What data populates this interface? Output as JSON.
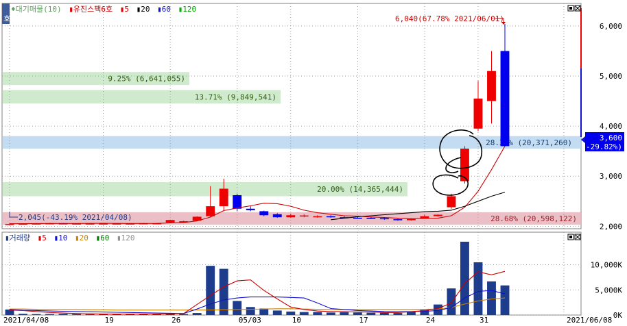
{
  "price_legend": {
    "prefix": "♦대기매물(10)",
    "stock": "유진스팩6호",
    "ma": [
      {
        "label": "5",
        "color": "#e00000"
      },
      {
        "label": "20",
        "color": "#000000"
      },
      {
        "label": "60",
        "color": "#1010d0"
      },
      {
        "label": "120",
        "color": "#00b000"
      }
    ]
  },
  "volume_legend": {
    "prefix": "거래량",
    "ma": [
      {
        "label": "5",
        "color": "#e00000"
      },
      {
        "label": "10",
        "color": "#1010d0"
      },
      {
        "label": "20",
        "color": "#d08000"
      },
      {
        "label": "60",
        "color": "#008000"
      },
      {
        "label": "120",
        "color": "#909090"
      }
    ]
  },
  "annotations": {
    "high": "6,040(67.78% 2021/06/01)",
    "low": "2,045(-43.19% 2021/04/08)",
    "current_price": "3,600",
    "current_change": "(-29.82%)"
  },
  "chart_data": [
    {
      "type": "candlestick",
      "dates": [
        "04/08",
        "04/09",
        "04/12",
        "04/13",
        "04/14",
        "04/15",
        "04/16",
        "04/19",
        "04/20",
        "04/21",
        "04/22",
        "04/23",
        "04/26",
        "04/27",
        "04/28",
        "04/29",
        "04/30",
        "05/03",
        "05/04",
        "05/06",
        "05/07",
        "05/10",
        "05/11",
        "05/12",
        "05/13",
        "05/14",
        "05/17",
        "05/18",
        "05/20",
        "05/21",
        "05/24",
        "05/25",
        "05/26",
        "05/27",
        "05/28",
        "05/31",
        "06/01"
      ],
      "candles": [
        {
          "o": 2045,
          "h": 2060,
          "l": 2045,
          "c": 2045
        },
        {
          "o": 2050,
          "h": 2055,
          "l": 2045,
          "c": 2050
        },
        {
          "o": 2055,
          "h": 2060,
          "l": 2050,
          "c": 2055
        },
        {
          "o": 2060,
          "h": 2065,
          "l": 2055,
          "c": 2060
        },
        {
          "o": 2060,
          "h": 2065,
          "l": 2055,
          "c": 2055
        },
        {
          "o": 2055,
          "h": 2060,
          "l": 2050,
          "c": 2055
        },
        {
          "o": 2055,
          "h": 2060,
          "l": 2050,
          "c": 2055
        },
        {
          "o": 2055,
          "h": 2060,
          "l": 2050,
          "c": 2055
        },
        {
          "o": 2055,
          "h": 2060,
          "l": 2050,
          "c": 2055
        },
        {
          "o": 2055,
          "h": 2060,
          "l": 2050,
          "c": 2055
        },
        {
          "o": 2060,
          "h": 2065,
          "l": 2055,
          "c": 2060
        },
        {
          "o": 2060,
          "h": 2065,
          "l": 2055,
          "c": 2060
        },
        {
          "o": 2075,
          "h": 2130,
          "l": 2070,
          "c": 2125
        },
        {
          "o": 2100,
          "h": 2110,
          "l": 2090,
          "c": 2100
        },
        {
          "o": 2110,
          "h": 2200,
          "l": 2100,
          "c": 2190
        },
        {
          "o": 2200,
          "h": 2800,
          "l": 2180,
          "c": 2400
        },
        {
          "o": 2400,
          "h": 2950,
          "l": 2300,
          "c": 2750
        },
        {
          "o": 2620,
          "h": 2650,
          "l": 2300,
          "c": 2350
        },
        {
          "o": 2350,
          "h": 2400,
          "l": 2300,
          "c": 2320
        },
        {
          "o": 2300,
          "h": 2310,
          "l": 2200,
          "c": 2220
        },
        {
          "o": 2240,
          "h": 2260,
          "l": 2170,
          "c": 2180
        },
        {
          "o": 2180,
          "h": 2250,
          "l": 2170,
          "c": 2220
        },
        {
          "o": 2200,
          "h": 2240,
          "l": 2180,
          "c": 2215
        },
        {
          "o": 2190,
          "h": 2220,
          "l": 2170,
          "c": 2200
        },
        {
          "o": 2200,
          "h": 2220,
          "l": 2170,
          "c": 2180
        },
        {
          "o": 2180,
          "h": 2200,
          "l": 2160,
          "c": 2175
        },
        {
          "o": 2170,
          "h": 2190,
          "l": 2150,
          "c": 2165
        },
        {
          "o": 2165,
          "h": 2185,
          "l": 2145,
          "c": 2160
        },
        {
          "o": 2160,
          "h": 2180,
          "l": 2130,
          "c": 2140
        },
        {
          "o": 2140,
          "h": 2150,
          "l": 2110,
          "c": 2120
        },
        {
          "o": 2120,
          "h": 2160,
          "l": 2110,
          "c": 2145
        },
        {
          "o": 2160,
          "h": 2230,
          "l": 2150,
          "c": 2200
        },
        {
          "o": 2200,
          "h": 2240,
          "l": 2190,
          "c": 2230
        },
        {
          "o": 2380,
          "h": 2650,
          "l": 2350,
          "c": 2600
        },
        {
          "o": 2900,
          "h": 3600,
          "l": 2850,
          "c": 3550
        },
        {
          "o": 3950,
          "h": 4900,
          "l": 3900,
          "c": 4550
        },
        {
          "o": 4500,
          "h": 5500,
          "l": 4050,
          "c": 5100
        }
      ],
      "last_candle": {
        "date": "06/01",
        "o": 5500,
        "h": 6040,
        "l": 3600,
        "c": 3600
      },
      "ma5": [
        2050,
        2052,
        2054,
        2056,
        2056,
        2056,
        2057,
        2058,
        2057,
        2056,
        2056,
        2057,
        2067,
        2075,
        2106,
        2183,
        2313,
        2365,
        2408,
        2460,
        2450,
        2400,
        2320,
        2270,
        2240,
        2210,
        2200,
        2185,
        2175,
        2160,
        2150,
        2155,
        2160,
        2210,
        2380,
        2700,
        3130,
        3600
      ],
      "ma20": [
        2130,
        2160,
        2190,
        2210,
        2230,
        2250,
        2270,
        2290,
        2300,
        2320,
        2400,
        2500,
        2600,
        2680
      ],
      "y_range": [
        1950,
        6450
      ],
      "yticks": [
        {
          "v": 2000,
          "label": "2,000"
        },
        {
          "v": 3000,
          "label": "3,000"
        },
        {
          "v": 4000,
          "label": "4,000"
        },
        {
          "v": 5000,
          "label": "5,000"
        },
        {
          "v": 6000,
          "label": "6,000"
        }
      ],
      "supply_zones": [
        {
          "lo": 2030,
          "hi": 2280,
          "label": "28.68% (20,598,122)",
          "color": "#e8b4bc",
          "text_color": "#9a1f2b"
        },
        {
          "lo": 2600,
          "hi": 2880,
          "label": "20.00% (14,365,444)",
          "color": "#c8e6c4",
          "text_color": "#2e5e12"
        },
        {
          "lo": 3550,
          "hi": 3800,
          "label": "28.36% (20,371,260)",
          "color": "#b8d6ee",
          "text_color": "#123e70"
        },
        {
          "lo": 4450,
          "hi": 4720,
          "label": "13.71% (9,849,541)",
          "color": "#c8e6c4",
          "text_color": "#2e5e12"
        },
        {
          "lo": 4820,
          "hi": 5080,
          "label": "9.25% (6,641,055)",
          "color": "#c8e6c4",
          "text_color": "#2e5e12"
        }
      ]
    },
    {
      "type": "bar",
      "y_range": [
        0,
        16500
      ],
      "yticks": [
        {
          "v": 0,
          "label": "0K"
        },
        {
          "v": 5000,
          "label": "5,000K"
        },
        {
          "v": 10000,
          "label": "10,000K"
        }
      ],
      "values": [
        1100,
        250,
        200,
        200,
        250,
        200,
        180,
        180,
        170,
        160,
        170,
        180,
        200,
        200,
        400,
        9800,
        9200,
        2800,
        1600,
        1300,
        900,
        700,
        600,
        600,
        500,
        550,
        500,
        450,
        450,
        400,
        700,
        1000,
        2100,
        5300,
        14600,
        10500,
        6700,
        5900
      ],
      "ma5": [
        1000,
        900,
        700,
        500,
        400,
        300,
        250,
        220,
        200,
        200,
        200,
        200,
        250,
        300,
        2100,
        3900,
        5600,
        6800,
        7000,
        4900,
        3200,
        1600,
        1100,
        800,
        700,
        700,
        600,
        600,
        500,
        500,
        650,
        900,
        1300,
        2400,
        6300,
        8600,
        8000,
        8700
      ],
      "ma10": [
        1100,
        950,
        900,
        800,
        750,
        700,
        650,
        600,
        550,
        500,
        450,
        400,
        350,
        300,
        1200,
        2200,
        3000,
        3400,
        3600,
        3600,
        3600,
        3500,
        3400,
        2400,
        1300,
        1100,
        900,
        800,
        700,
        650,
        700,
        750,
        900,
        1500,
        3400,
        4700,
        4900,
        4200
      ],
      "ma20": [
        1200,
        1200,
        1150,
        1100,
        1100,
        1100,
        1050,
        1050,
        1000,
        1000,
        1000,
        1000,
        1000,
        1000,
        1000,
        1000,
        1050,
        1100,
        1150,
        1200,
        1250,
        1250,
        1200,
        1150,
        1100,
        1100,
        1100,
        1100,
        1100,
        1100,
        1100,
        1150,
        1200,
        1500,
        2200,
        2800,
        3200,
        3400
      ]
    }
  ],
  "x_axis": {
    "ticks": [
      {
        "i": 0,
        "label": "2021/04/08"
      },
      {
        "i": 7,
        "label": "19"
      },
      {
        "i": 12,
        "label": "26"
      },
      {
        "i": 17,
        "label": "05/03"
      },
      {
        "i": 21,
        "label": "10"
      },
      {
        "i": 26,
        "label": "17"
      },
      {
        "i": 31,
        "label": "24"
      },
      {
        "i": 35,
        "label": "31"
      }
    ],
    "end_label": "2021/06/08"
  },
  "colors": {
    "up": "#ee0000",
    "down": "#0000ee",
    "grid": "#9a9a9a",
    "volume_bar": "#1e3c8c"
  }
}
